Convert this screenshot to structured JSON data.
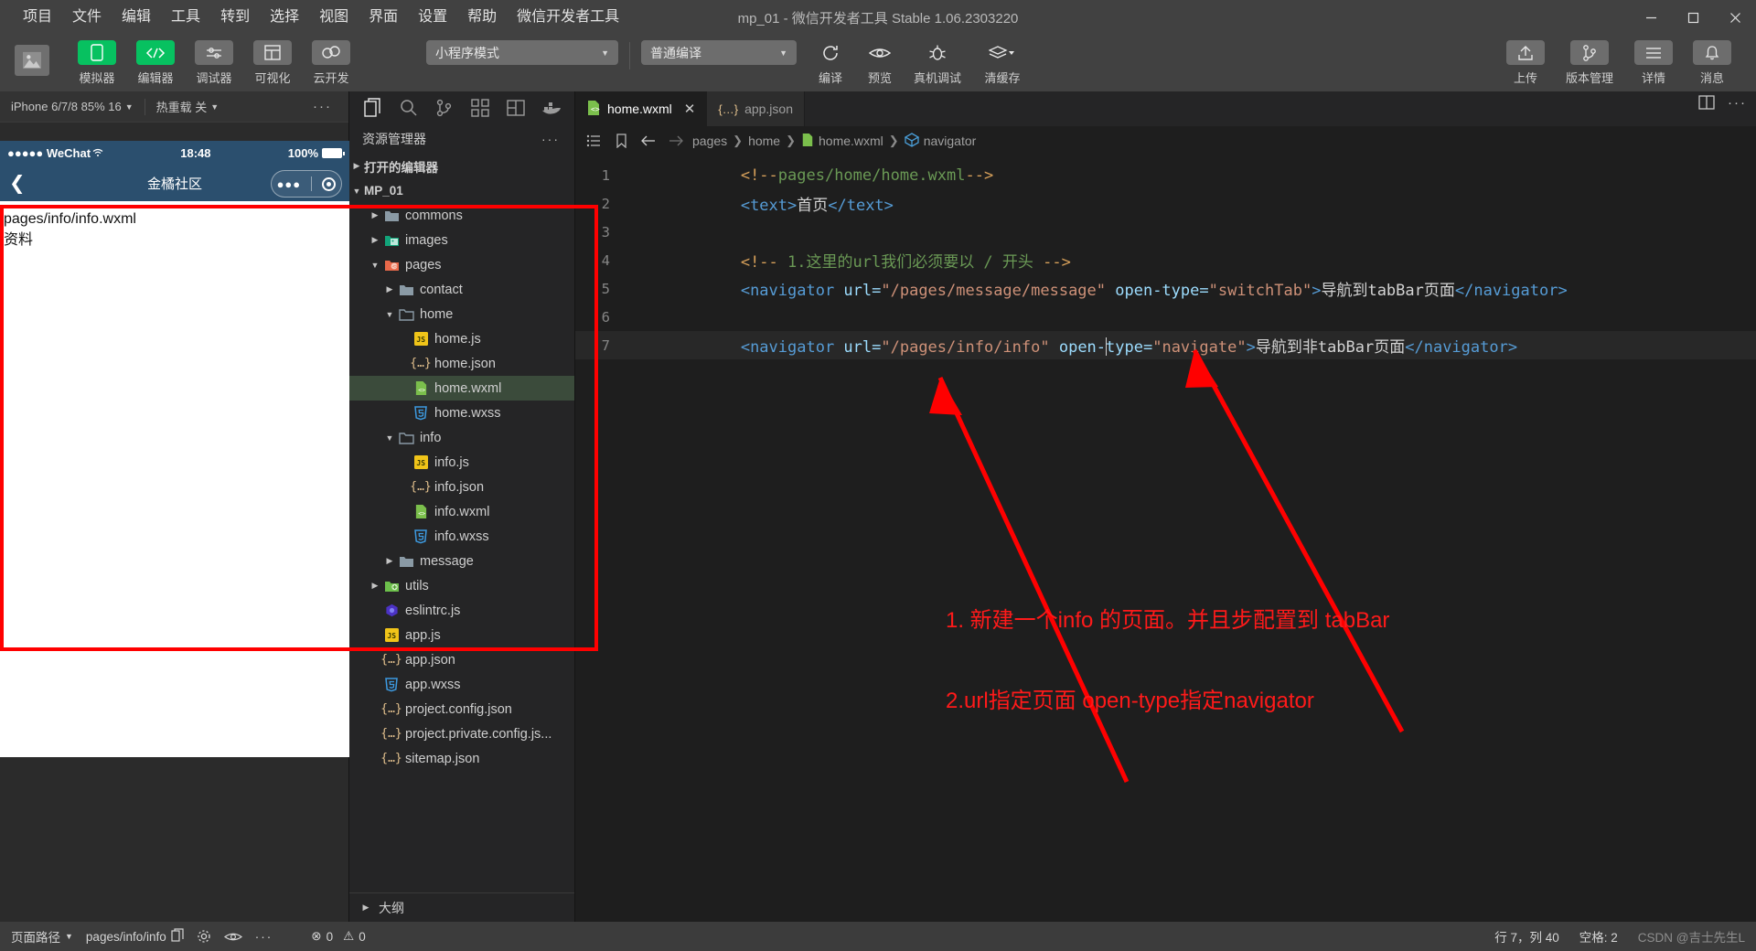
{
  "window": {
    "title": "mp_01 - 微信开发者工具 Stable 1.06.2303220",
    "minimize": "—",
    "maximize": "▢",
    "close": "✕"
  },
  "menubar": {
    "items": [
      {
        "label": "项目"
      },
      {
        "label": "文件"
      },
      {
        "label": "编辑"
      },
      {
        "label": "工具"
      },
      {
        "label": "转到"
      },
      {
        "label": "选择"
      },
      {
        "label": "视图"
      },
      {
        "label": "界面"
      },
      {
        "label": "设置"
      },
      {
        "label": "帮助"
      },
      {
        "label": "微信开发者工具"
      }
    ]
  },
  "toolbar": {
    "left_buttons": [
      {
        "label": "模拟器",
        "icon": "phone-icon",
        "active": true
      },
      {
        "label": "编辑器",
        "icon": "code-icon",
        "active": true
      },
      {
        "label": "调试器",
        "icon": "sliders-icon",
        "active": false
      },
      {
        "label": "可视化",
        "icon": "layout-icon",
        "active": false
      },
      {
        "label": "云开发",
        "icon": "cloud-icon",
        "active": false
      }
    ],
    "mode_select": {
      "value": "小程序模式",
      "caret": "▼"
    },
    "compile_select": {
      "value": "普通编译",
      "caret": "▼"
    },
    "action_buttons": [
      {
        "label": "编译",
        "icon": "refresh-icon"
      },
      {
        "label": "预览",
        "icon": "eye-icon"
      },
      {
        "label": "真机调试",
        "icon": "bug-icon"
      },
      {
        "label": "清缓存",
        "icon": "layers-icon",
        "caret": "▼"
      }
    ],
    "right_buttons": [
      {
        "label": "上传",
        "icon": "upload-icon"
      },
      {
        "label": "版本管理",
        "icon": "branch-icon"
      },
      {
        "label": "详情",
        "icon": "menu-icon"
      },
      {
        "label": "消息",
        "icon": "bell-icon"
      }
    ]
  },
  "simulator": {
    "device": "iPhone 6/7/8 85% 16",
    "device_caret": "▼",
    "hot_reload": "热重载 关",
    "hot_reload_caret": "▼",
    "more": "···",
    "status_bar": {
      "carrier": "●●●●● WeChat",
      "wifi": "⌃",
      "time": "18:48",
      "battery_pct": "100%"
    },
    "nav": {
      "back": "❮",
      "title": "金橘社区",
      "capsule_dots": "●●●"
    },
    "page_lines": [
      "pages/info/info.wxml",
      "资料"
    ]
  },
  "explorer": {
    "activity_icons": [
      {
        "name": "files-icon",
        "active": true
      },
      {
        "name": "search-icon",
        "active": false
      },
      {
        "name": "source-control-icon",
        "active": false
      },
      {
        "name": "extensions-icon",
        "active": false
      },
      {
        "name": "layout-panel-icon",
        "active": false
      },
      {
        "name": "cloud-docker-icon",
        "active": false
      }
    ],
    "title": "资源管理器",
    "more": "···",
    "open_editors": {
      "label": "打开的编辑器",
      "twisty": "▶"
    },
    "project": {
      "label": "MP_01",
      "twisty": "▼"
    },
    "tree": [
      {
        "label": "commons",
        "indent": 1,
        "twisty": "▶",
        "icon": "folder",
        "kind": "folder"
      },
      {
        "label": "images",
        "indent": 1,
        "twisty": "▶",
        "icon": "folder-images",
        "kind": "folder"
      },
      {
        "label": "pages",
        "indent": 1,
        "twisty": "▼",
        "icon": "folder-pages",
        "kind": "folder"
      },
      {
        "label": "contact",
        "indent": 2,
        "twisty": "▶",
        "icon": "folder",
        "kind": "folder"
      },
      {
        "label": "home",
        "indent": 2,
        "twisty": "▼",
        "icon": "folder-open",
        "kind": "folder"
      },
      {
        "label": "home.js",
        "indent": 3,
        "twisty": "",
        "icon": "js",
        "kind": "file"
      },
      {
        "label": "home.json",
        "indent": 3,
        "twisty": "",
        "icon": "json",
        "kind": "file"
      },
      {
        "label": "home.wxml",
        "indent": 3,
        "twisty": "",
        "icon": "wxml",
        "kind": "file",
        "selected": true
      },
      {
        "label": "home.wxss",
        "indent": 3,
        "twisty": "",
        "icon": "wxss",
        "kind": "file"
      },
      {
        "label": "info",
        "indent": 2,
        "twisty": "▼",
        "icon": "folder-open",
        "kind": "folder"
      },
      {
        "label": "info.js",
        "indent": 3,
        "twisty": "",
        "icon": "js",
        "kind": "file"
      },
      {
        "label": "info.json",
        "indent": 3,
        "twisty": "",
        "icon": "json",
        "kind": "file"
      },
      {
        "label": "info.wxml",
        "indent": 3,
        "twisty": "",
        "icon": "wxml",
        "kind": "file"
      },
      {
        "label": "info.wxss",
        "indent": 3,
        "twisty": "",
        "icon": "wxss",
        "kind": "file"
      },
      {
        "label": "message",
        "indent": 2,
        "twisty": "▶",
        "icon": "folder",
        "kind": "folder"
      },
      {
        "label": "utils",
        "indent": 1,
        "twisty": "▶",
        "icon": "folder-utils",
        "kind": "folder"
      },
      {
        "label": "eslintrc.js",
        "indent": 1,
        "twisty": "",
        "icon": "eslint",
        "kind": "file"
      },
      {
        "label": "app.js",
        "indent": 1,
        "twisty": "",
        "icon": "js",
        "kind": "file"
      },
      {
        "label": "app.json",
        "indent": 1,
        "twisty": "",
        "icon": "json",
        "kind": "file"
      },
      {
        "label": "app.wxss",
        "indent": 1,
        "twisty": "",
        "icon": "wxss",
        "kind": "file"
      },
      {
        "label": "project.config.json",
        "indent": 1,
        "twisty": "",
        "icon": "json",
        "kind": "file"
      },
      {
        "label": "project.private.config.js...",
        "indent": 1,
        "twisty": "",
        "icon": "json",
        "kind": "file"
      },
      {
        "label": "sitemap.json",
        "indent": 1,
        "twisty": "",
        "icon": "json",
        "kind": "file"
      }
    ],
    "outline": {
      "label": "大纲",
      "twisty": "▶"
    }
  },
  "editor": {
    "tabs": [
      {
        "label": "home.wxml",
        "icon": "wxml",
        "active": true,
        "close": "✕"
      },
      {
        "label": "app.json",
        "icon": "json",
        "active": false
      }
    ],
    "breadcrumb": {
      "items": [
        "pages",
        "home",
        "home.wxml",
        "navigator"
      ],
      "separator": "❯"
    },
    "lines": [
      {
        "n": "1"
      },
      {
        "n": "2"
      },
      {
        "n": "3"
      },
      {
        "n": "4"
      },
      {
        "n": "5"
      },
      {
        "n": "6"
      },
      {
        "n": "7"
      }
    ],
    "code_text": {
      "l1": "<!--pages/home/home.wxml-->",
      "l2": "<text>首页</text>",
      "l3": "",
      "l4": "<!-- 1.这里的url我们必须要以 / 开头 -->",
      "l5": "<navigator url=\"/pages/message/message\" open-type=\"switchTab\">导航到tabBar页面</navigator>",
      "l6": "",
      "l7": "<navigator url=\"/pages/info/info\" open-type=\"navigate\">导航到非tabBar页面</navigator>"
    },
    "tokens": {
      "comment_open": "<!--",
      "comment_close": "-->",
      "l1_body": "pages/home/home.wxml",
      "l2_tag_open": "<text>",
      "l2_content": "首页",
      "l2_tag_close": "</text>",
      "l4_body": " 1.这里的url我们必须要以 / 开头 ",
      "tag_nav_open": "<navigator",
      "attr_url": " url=",
      "l5_url_val": "\"/pages/message/message\"",
      "attr_opentype": " open-type=",
      "l5_opentype_val": "\"switchTab\"",
      "gt": ">",
      "l5_inner": "导航到tabBar页面",
      "tag_nav_close": "</navigator>",
      "l7_url_val": "\"/pages/info/info\"",
      "l7_attr_opentype_a": " open-",
      "l7_attr_opentype_b": "type=",
      "l7_opentype_val": "\"navigate\"",
      "l7_inner": "导航到非tabBar页面"
    },
    "right_icons": [
      "split-editor-icon",
      "more-icon"
    ]
  },
  "annotations": [
    {
      "text": "1. 新建一个info 的页面。并且步配置到 tabBar",
      "color": "#ff1a1a"
    },
    {
      "text": "2.url指定页面 open-type指定navigator",
      "color": "#ff1a1a"
    }
  ],
  "statusbar": {
    "page_path_label": "页面路径",
    "page_path_caret": "▼",
    "page_path_value": "pages/info/info",
    "copy_icon": "copy-icon",
    "problems": {
      "errors": "0",
      "warnings": "0",
      "error_icon": "⊗",
      "warn_icon": "⚠"
    },
    "cursor": "行 7，列 40",
    "spaces": "空格: 2",
    "watermark": "CSDN @吉士先生L"
  }
}
